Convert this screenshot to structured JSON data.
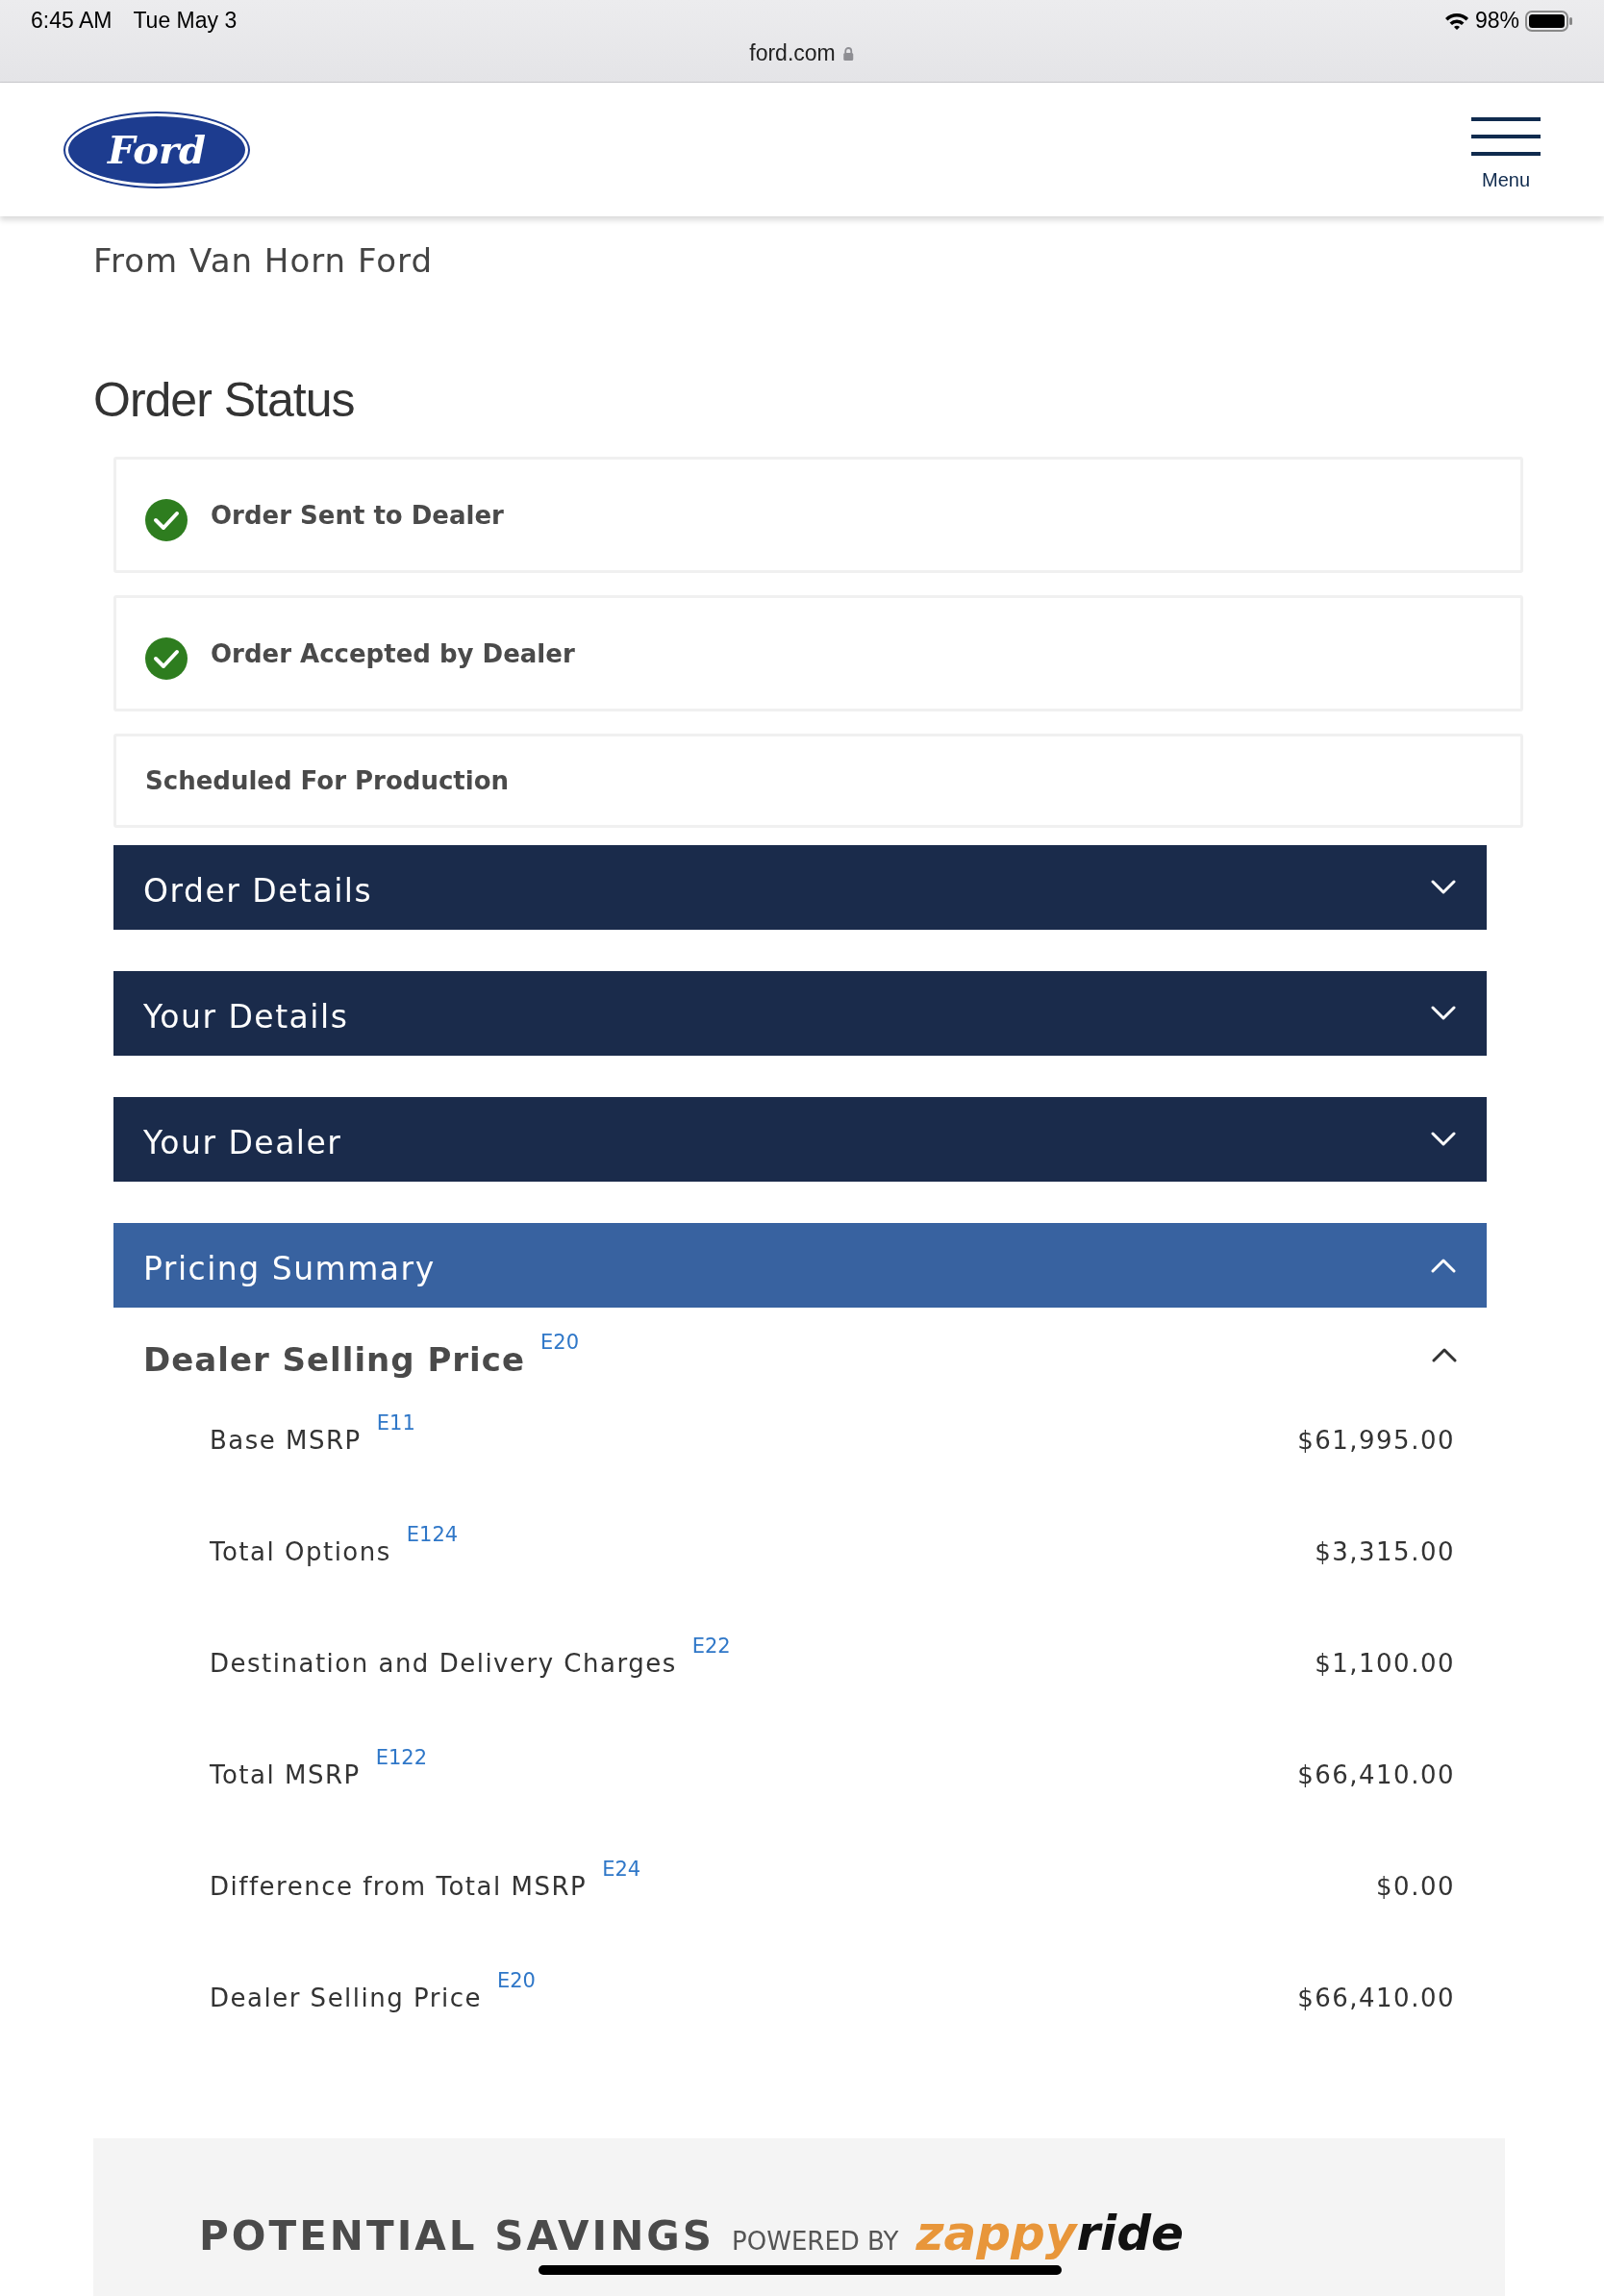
{
  "status_bar": {
    "time": "6:45 AM",
    "date": "Tue May 3",
    "url": "ford.com",
    "battery": "98%"
  },
  "header": {
    "logo": "Ford",
    "menu_label": "Menu"
  },
  "dealer_line": "From Van Horn Ford",
  "order_status": {
    "title": "Order Status",
    "steps": [
      {
        "label": "Order Sent to Dealer",
        "completed": true
      },
      {
        "label": "Order Accepted by Dealer",
        "completed": true
      },
      {
        "label": "Scheduled For Production",
        "completed": false
      }
    ]
  },
  "sections": [
    {
      "title": "Order Details",
      "expanded": false
    },
    {
      "title": "Your Details",
      "expanded": false
    },
    {
      "title": "Your Dealer",
      "expanded": false
    },
    {
      "title": "Pricing Summary",
      "expanded": true
    }
  ],
  "pricing": {
    "heading": "Dealer Selling Price",
    "heading_ref": "E20",
    "expanded": true,
    "rows": [
      {
        "label": "Base MSRP",
        "ref": "E11",
        "value": "$61,995.00"
      },
      {
        "label": "Total Options",
        "ref": "E124",
        "value": "$3,315.00"
      },
      {
        "label": "Destination and Delivery Charges",
        "ref": "E22",
        "value": "$1,100.00"
      },
      {
        "label": "Total MSRP",
        "ref": "E122",
        "value": "$66,410.00"
      },
      {
        "label": "Difference from Total MSRP",
        "ref": "E24",
        "value": "$0.00"
      },
      {
        "label": "Dealer Selling Price",
        "ref": "E20",
        "value": "$66,410.00"
      }
    ]
  },
  "savings": {
    "title": "POTENTIAL SAVINGS",
    "powered_by": "POWERED BY",
    "brand_part_1": "zappy",
    "brand_part_2": "ride"
  }
}
